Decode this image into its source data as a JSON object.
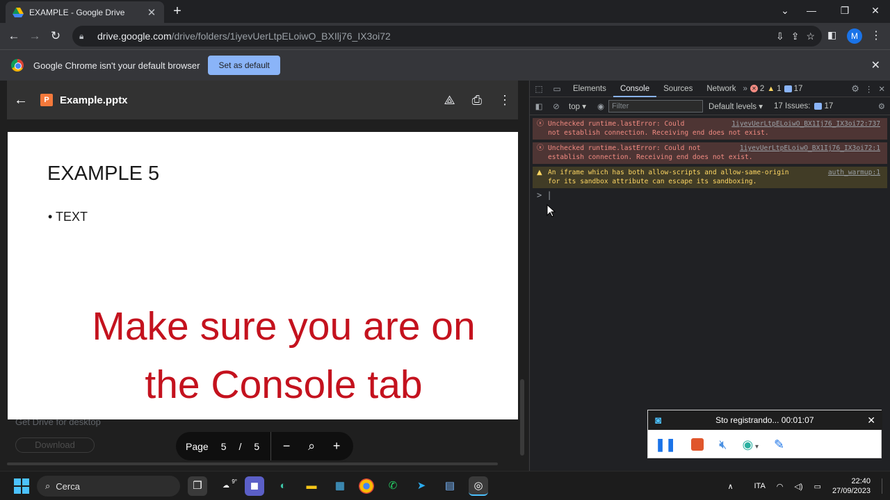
{
  "browser": {
    "tab_title": "EXAMPLE - Google Drive",
    "url_domain": "drive.google.com",
    "url_path": "/drive/folders/1iyevUerLtpELoiwO_BXIlj76_IX3oi72",
    "avatar_letter": "M"
  },
  "infobar": {
    "message": "Google Chrome isn't your default browser",
    "button": "Set as default"
  },
  "viewer": {
    "file_name": "Example.pptx",
    "file_type_letter": "P",
    "slide_title": "EXAMPLE 5",
    "slide_bullet": "• TEXT",
    "overlay_text_line1": "Make sure you are on",
    "overlay_text_line2": "the Console tab",
    "ghost_text": "Get Drive for desktop",
    "ghost_button": "Download",
    "pager": {
      "label": "Page",
      "current": "5",
      "separator": "/",
      "total": "5"
    }
  },
  "devtools": {
    "tabs": [
      "Elements",
      "Console",
      "Sources",
      "Network"
    ],
    "active_tab": "Console",
    "errors": "2",
    "warnings": "1",
    "issues_badge": "17",
    "context": "top",
    "filter_placeholder": "Filter",
    "levels": "Default levels",
    "issues_label": "17 Issues:",
    "issues_count": "17",
    "messages": [
      {
        "type": "error",
        "text1": "Unchecked runtime.lastError: Could",
        "text2": "not establish connection. Receiving end does not exist.",
        "source": "1iyevUerLtpELoiwO_BX1Ij76_IX3oi72:737"
      },
      {
        "type": "error",
        "text1": "Unchecked runtime.lastError: Could not",
        "text2": "establish connection. Receiving end does not exist.",
        "source": "1iyevUerLtpELoiwO_BX1Ij76_IX3oi72:1"
      },
      {
        "type": "warning",
        "text1": "An iframe which has both allow-scripts and allow-same-origin",
        "text2": "for its sandbox attribute can escape its sandboxing.",
        "source": "auth_warmup:1"
      }
    ],
    "prompt": ">"
  },
  "recorder": {
    "status": "Sto registrando... 00:01:07"
  },
  "taskbar": {
    "search_placeholder": "Cerca",
    "language": "ITA",
    "time": "22:40",
    "date": "27/09/2023",
    "weather": "9°"
  },
  "colors": {
    "overlay_red": "#c4121e",
    "accent_blue": "#8ab4f8",
    "error_bg": "#4e3534",
    "warn_bg": "#413c26"
  }
}
